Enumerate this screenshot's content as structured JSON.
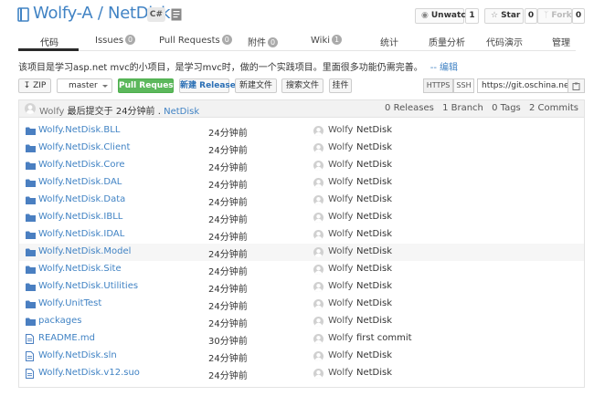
{
  "repo": {
    "owner": "Wolfy-A",
    "separator": " / ",
    "name": "NetDisk",
    "lang": "C#"
  },
  "actions": {
    "unwatch_label": "Unwatch",
    "unwatch_count": "1",
    "star_label": "Star",
    "star_count": "0",
    "fork_label": "Fork",
    "fork_count": "0"
  },
  "tabs": [
    {
      "label": "代码",
      "count": ""
    },
    {
      "label": "Issues",
      "count": "0"
    },
    {
      "label": "Pull Requests",
      "count": "0"
    },
    {
      "label": "附件",
      "count": "0"
    },
    {
      "label": "Wiki",
      "count": "1"
    },
    {
      "label": "统计",
      "count": ""
    },
    {
      "label": "质量分析",
      "count": ""
    },
    {
      "label": "代码演示",
      "count": ""
    },
    {
      "label": "管理",
      "count": ""
    }
  ],
  "description": {
    "text": "该项目是学习asp.net mvc的小项目，是学习mvc时，做的一个实践项目。里面很多功能仍需完善。",
    "dash": "--",
    "edit_label": "编辑"
  },
  "toolbar": {
    "zip_label": "ZIP",
    "branch": "master",
    "pull_request_label": "Pull Request",
    "new_release_label": "新建 Release",
    "new_file_label": "新建文件",
    "search_file_label": "搜索文件",
    "hook_label": "挂件",
    "https_label": "HTTPS",
    "ssh_label": "SSH",
    "clone_url": "https://git.oschina.net/w"
  },
  "last_commit": {
    "user": "Wolfy",
    "text": "最后提交于 24分钟前 .",
    "link": "NetDisk"
  },
  "stats": {
    "releases": "0 Releases",
    "branches": "1 Branch",
    "tags": "0 Tags",
    "commits": "2 Commits"
  },
  "files": [
    {
      "name": "Wolfy.NetDisk.BLL",
      "type": "folder",
      "time": "24分钟前",
      "author": "Wolfy",
      "message": "NetDisk"
    },
    {
      "name": "Wolfy.NetDisk.Client",
      "type": "folder",
      "time": "24分钟前",
      "author": "Wolfy",
      "message": "NetDisk"
    },
    {
      "name": "Wolfy.NetDisk.Core",
      "type": "folder",
      "time": "24分钟前",
      "author": "Wolfy",
      "message": "NetDisk"
    },
    {
      "name": "Wolfy.NetDisk.DAL",
      "type": "folder",
      "time": "24分钟前",
      "author": "Wolfy",
      "message": "NetDisk"
    },
    {
      "name": "Wolfy.NetDisk.Data",
      "type": "folder",
      "time": "24分钟前",
      "author": "Wolfy",
      "message": "NetDisk"
    },
    {
      "name": "Wolfy.NetDisk.IBLL",
      "type": "folder",
      "time": "24分钟前",
      "author": "Wolfy",
      "message": "NetDisk"
    },
    {
      "name": "Wolfy.NetDisk.IDAL",
      "type": "folder",
      "time": "24分钟前",
      "author": "Wolfy",
      "message": "NetDisk"
    },
    {
      "name": "Wolfy.NetDisk.Model",
      "type": "folder",
      "time": "24分钟前",
      "author": "Wolfy",
      "message": "NetDisk"
    },
    {
      "name": "Wolfy.NetDisk.Site",
      "type": "folder",
      "time": "24分钟前",
      "author": "Wolfy",
      "message": "NetDisk"
    },
    {
      "name": "Wolfy.NetDisk.Utilities",
      "type": "folder",
      "time": "24分钟前",
      "author": "Wolfy",
      "message": "NetDisk"
    },
    {
      "name": "Wolfy.UnitTest",
      "type": "folder",
      "time": "24分钟前",
      "author": "Wolfy",
      "message": "NetDisk"
    },
    {
      "name": "packages",
      "type": "folder",
      "time": "24分钟前",
      "author": "Wolfy",
      "message": "NetDisk"
    },
    {
      "name": "README.md",
      "type": "file",
      "time": "30分钟前",
      "author": "Wolfy",
      "message": "first commit"
    },
    {
      "name": "Wolfy.NetDisk.sln",
      "type": "file",
      "time": "24分钟前",
      "author": "Wolfy",
      "message": "NetDisk"
    },
    {
      "name": "Wolfy.NetDisk.v12.suo",
      "type": "file",
      "time": "24分钟前",
      "author": "Wolfy",
      "message": "NetDisk"
    }
  ],
  "colors": {
    "link": "#4183c4",
    "green": "#5cb85c",
    "folder": "#4a7fc1"
  }
}
